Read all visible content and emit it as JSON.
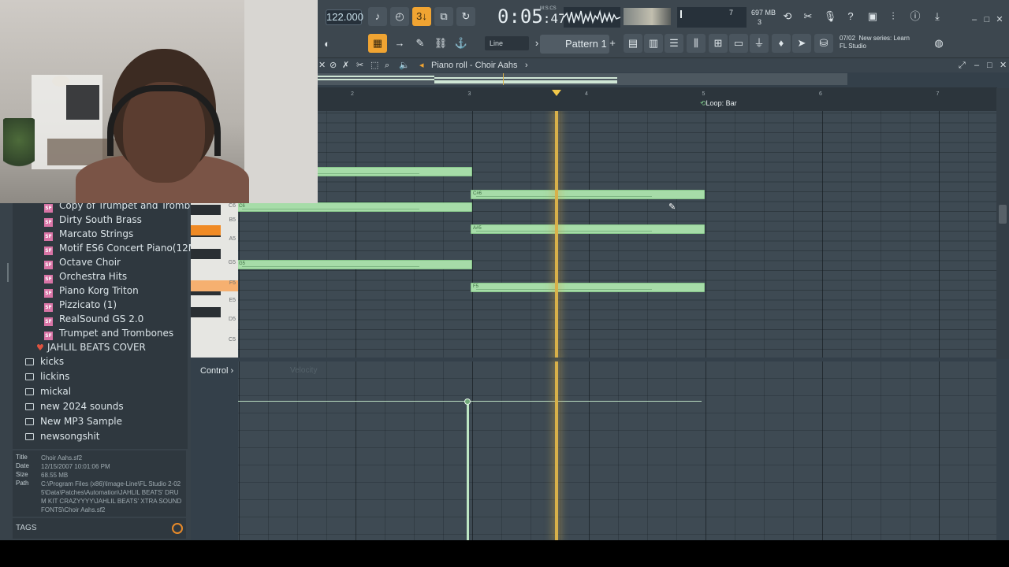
{
  "toolbar": {
    "tempo": "122.000",
    "time_main": "0:05",
    "time_sub": ":47",
    "time_unit": "M:S:CS",
    "cpu_value": "7",
    "memory": "697 MB",
    "poly": "3",
    "pattern": "Pattern 1",
    "line_mode": "Line",
    "hint_date": "07/02",
    "hint_title": "New series: Learn",
    "hint_sub": "FL Studio",
    "snap_label": "3↓"
  },
  "piano_roll": {
    "title": "Piano roll - Choir Aahs",
    "title_arrow": "›",
    "ruler_bars": [
      "2",
      "3",
      "4",
      "5",
      "6",
      "7"
    ],
    "loop_label": "Loop: Bar",
    "key_labels": [
      "C6",
      "B5",
      "A5",
      "G5",
      "F5",
      "E5",
      "D5",
      "C5"
    ],
    "notes": [
      {
        "label": "C#6",
        "row": 1,
        "start": 3,
        "end": 5
      },
      {
        "label": "A#5",
        "row": 3,
        "start": 3,
        "end": 5
      },
      {
        "label": "F5",
        "row": 6,
        "start": 3,
        "end": 5
      },
      {
        "label": "",
        "row": 0,
        "start": 1,
        "end": 3
      },
      {
        "label": "C6",
        "row": 2,
        "start": 1,
        "end": 3
      },
      {
        "label": "G5",
        "row": 5,
        "start": 1,
        "end": 3
      }
    ],
    "control_label": "Control",
    "control_arrow": "›",
    "velocity_label": "Velocity"
  },
  "browser": {
    "items": [
      {
        "type": "sf",
        "label": "Copy of Trumpet and Trombones"
      },
      {
        "type": "sf",
        "label": "Dirty South Brass"
      },
      {
        "type": "sf",
        "label": "Marcato Strings"
      },
      {
        "type": "sf",
        "label": "Motif ES6 Concert Piano(12Mb)"
      },
      {
        "type": "sf",
        "label": "Octave Choir"
      },
      {
        "type": "sf",
        "label": "Orchestra Hits"
      },
      {
        "type": "sf",
        "label": "Piano Korg Triton"
      },
      {
        "type": "sf",
        "label": "Pizzicato (1)"
      },
      {
        "type": "sf",
        "label": "RealSound GS 2.0"
      },
      {
        "type": "sf",
        "label": "Trumpet and Trombones"
      },
      {
        "type": "project",
        "label": "JAHLIL BEATS COVER"
      },
      {
        "type": "folder",
        "label": "kicks"
      },
      {
        "type": "folder",
        "label": "lickins"
      },
      {
        "type": "folder",
        "label": "mickal"
      },
      {
        "type": "folder",
        "label": "new 2024 sounds"
      },
      {
        "type": "folder",
        "label": "New MP3 Sample"
      },
      {
        "type": "folder",
        "label": "newsongshit"
      }
    ],
    "sf_badge": "SF",
    "info": {
      "title_key": "Title",
      "title": "Choir Aahs.sf2",
      "date_key": "Date",
      "date": "12/15/2007 10:01:06 PM",
      "size_key": "Size",
      "size": "68.55 MB",
      "path_key": "Path",
      "path": "C:\\Program Files (x86)\\Image-Line\\FL Studio 2-025\\Data\\Patches\\Automation\\JAHLIL BEATS' DRUM KIT    CRAZYYYY\\JAHLIL BEATS' XTRA SOUNDFONTS\\Choir Aahs.sf2"
    },
    "tags_label": "TAGS"
  },
  "colors": {
    "note": "#a6dca8",
    "playhead": "#d8b04a",
    "accent": "#f0a432"
  }
}
